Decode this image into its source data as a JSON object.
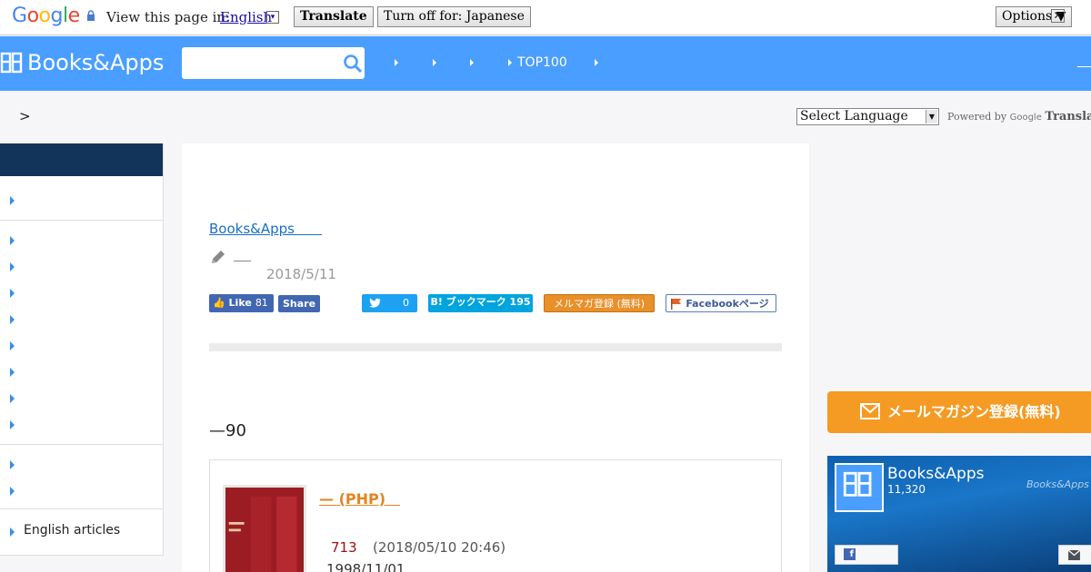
{
  "google_bar": {
    "logo": [
      "G",
      "o",
      "o",
      "g",
      "l",
      "e"
    ],
    "view_text": "View this page in:",
    "language": "English",
    "language_dropdown": "▾",
    "translate_label": "Translate",
    "turnoff_label": "Turn off for: Japanese",
    "options_label": "Options ▼",
    "close_label": "✕"
  },
  "header": {
    "logo_text": "Books&Apps",
    "search_placeholder": "",
    "nav_items": [
      "",
      "",
      "",
      "TOP100",
      ""
    ]
  },
  "breadcrumb": ">",
  "translate_widget": {
    "select_label": "Select Language",
    "arrow": "▼",
    "powered_by": "Powered by",
    "google": "Google",
    "translate": "Translate"
  },
  "sidebar": {
    "english_label": "English articles"
  },
  "article": {
    "site_link": "Books&Apps　　",
    "author": "",
    "date": "2018/5/11",
    "share": {
      "like_label": "Like",
      "like_count": "81",
      "share_label": "Share",
      "tweet_count": "0",
      "hatena_label": "B! ブックマーク",
      "hatena_count": "195",
      "mail_label": "メルマガ登録 (無料)",
      "fbpage_label": "Facebookページ"
    },
    "heading": "—90",
    "book": {
      "title": "— (PHP)　",
      "rank": "713",
      "timestamp": "(2018/05/10 20:46)",
      "release_date": "1998/11/01"
    }
  },
  "right": {
    "mail_button": "メールマガジン登録(無料)",
    "fb_widget": {
      "name": "Books&Apps",
      "count": "11,320",
      "watermark": "Books&Apps"
    }
  },
  "colors": {
    "header_blue": "#4a9eff",
    "sidebar_head": "#12345a",
    "mail_orange": "#f59a23",
    "book_link": "#e3841f"
  }
}
